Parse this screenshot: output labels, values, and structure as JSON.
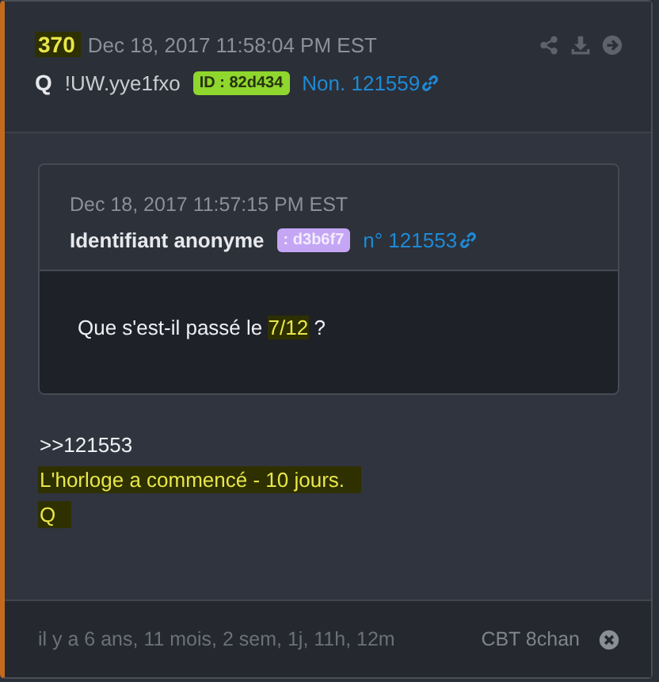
{
  "post": {
    "number": "370",
    "number_highlighted": true,
    "date": "Dec 18, 2017 11:58:04 PM EST",
    "author": "Q",
    "tripcode": "!UW.yye1fxo",
    "id_badge": "ID : 82d434",
    "post_link": "Non. 121559"
  },
  "quote": {
    "date": "Dec 18, 2017 11:57:15 PM EST",
    "author": "Identifiant anonyme",
    "id_badge": ": d3b6f7",
    "post_link": "n° 121553",
    "message": [
      {
        "text": "Que s'est-il passé le ",
        "highlighted": false
      },
      {
        "text": "7/12",
        "highlighted": true
      },
      {
        "text": " ?",
        "highlighted": false
      }
    ]
  },
  "body": [
    {
      "text": ">>121553",
      "highlighted": false
    },
    {
      "text": "L'horloge a commencé - 10 jours.",
      "highlighted": true
    },
    {
      "text": "Q",
      "highlighted": true
    }
  ],
  "footer": {
    "age": "il y a 6 ans, 11 mois, 2 sem, 1j, 11h, 12m",
    "source": "CBT 8chan"
  }
}
